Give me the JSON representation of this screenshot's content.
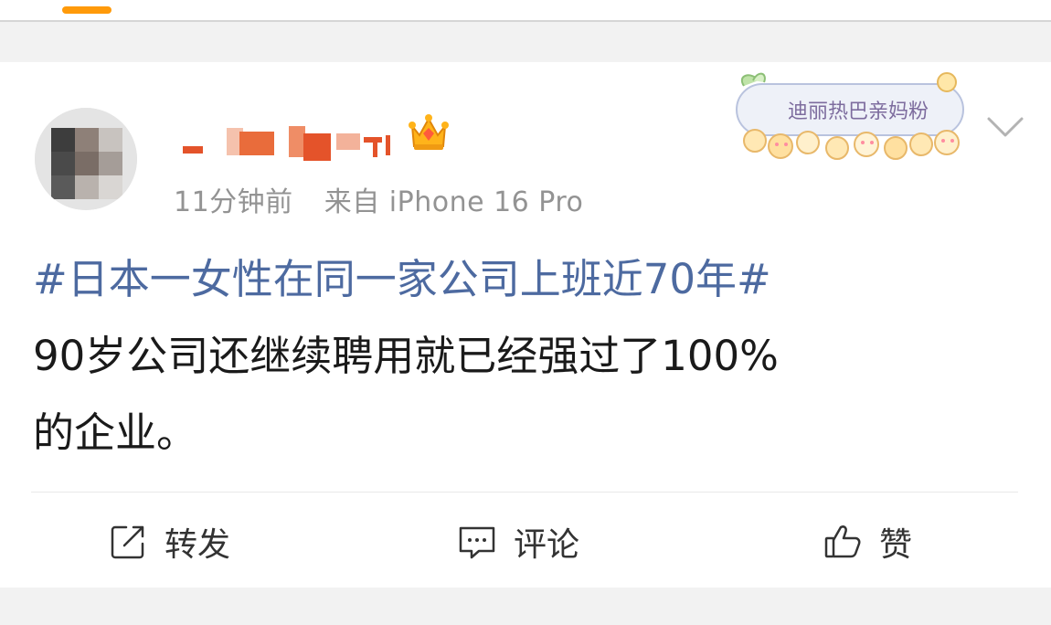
{
  "post": {
    "meta": {
      "time": "11分钟前",
      "source": "来自 iPhone 16 Pro"
    },
    "badge": {
      "label": "迪丽热巴亲妈粉"
    },
    "content": {
      "topic": "#日本一女性在同一家公司上班近70年#",
      "line2": "90岁公司还继续聘用就已经强过了100%",
      "line3": "的企业。"
    },
    "actions": {
      "repost_label": "转发",
      "comment_label": "评论",
      "like_label": "赞"
    }
  },
  "colors": {
    "topic": "#4d6aa0",
    "meta": "#939393",
    "tab_indicator": "#ff9a0a",
    "background": "#f2f2f2"
  },
  "icons": [
    "crown-icon",
    "chevron-down-icon",
    "repost-icon",
    "comment-icon",
    "like-icon"
  ]
}
